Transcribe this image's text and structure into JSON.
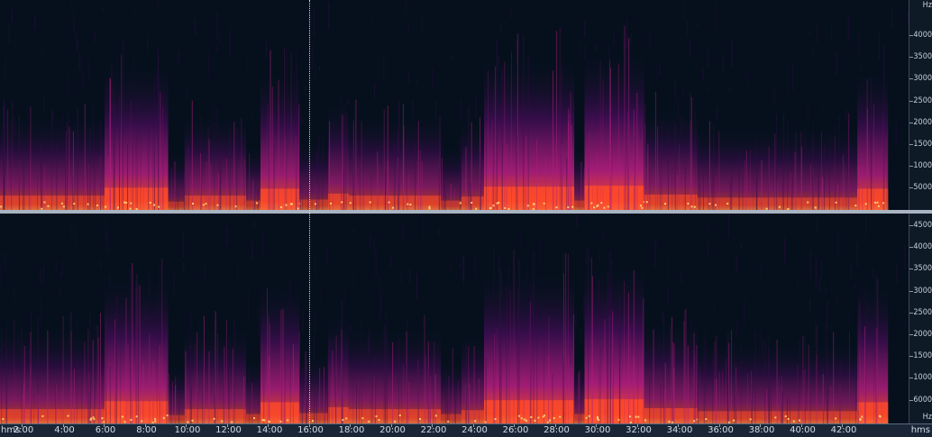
{
  "title": "",
  "time_axis": {
    "unit_left": "hms",
    "unit_right": "hms",
    "ticks": [
      {
        "label": "2:00",
        "minutes": 2
      },
      {
        "label": "4:00",
        "minutes": 4
      },
      {
        "label": "6:00",
        "minutes": 6
      },
      {
        "label": "8:00",
        "minutes": 8
      },
      {
        "label": "10:00",
        "minutes": 10
      },
      {
        "label": "12:00",
        "minutes": 12
      },
      {
        "label": "14:00",
        "minutes": 14
      },
      {
        "label": "16:00",
        "minutes": 16
      },
      {
        "label": "18:00",
        "minutes": 18
      },
      {
        "label": "20:00",
        "minutes": 20
      },
      {
        "label": "22:00",
        "minutes": 22
      },
      {
        "label": "24:00",
        "minutes": 24
      },
      {
        "label": "26:00",
        "minutes": 26
      },
      {
        "label": "28:00",
        "minutes": 28
      },
      {
        "label": "30:00",
        "minutes": 30
      },
      {
        "label": "32:00",
        "minutes": 32
      },
      {
        "label": "34:00",
        "minutes": 34
      },
      {
        "label": "36:00",
        "minutes": 36
      },
      {
        "label": "38:00",
        "minutes": 38
      },
      {
        "label": "40:00",
        "minutes": 40
      },
      {
        "label": "42:00",
        "minutes": 42
      }
    ],
    "cursor_minutes": 16
  },
  "freq_axis_top": {
    "unit": "Hz",
    "labels": [
      "4000",
      "3500",
      "3000",
      "2500",
      "2000",
      "1500",
      "1000",
      "5000"
    ]
  },
  "freq_axis_bottom": {
    "unit": "Hz",
    "labels": [
      "4500",
      "4000",
      "3500",
      "3000",
      "2500",
      "2000",
      "1500",
      "1000",
      "6000"
    ]
  },
  "colors": {
    "background": "#06101d",
    "low": "#3a0d4e",
    "mid": "#b01e7c",
    "high": "#ff4a2a",
    "peak": "#ffe27a",
    "cursor": "#e8e860"
  },
  "segments": [
    {
      "start": 0.0,
      "end": 5.1,
      "level": 0.45
    },
    {
      "start": 5.1,
      "end": 8.2,
      "level": 0.85
    },
    {
      "start": 8.2,
      "end": 9.0,
      "level": 0.15
    },
    {
      "start": 9.0,
      "end": 12.0,
      "level": 0.45
    },
    {
      "start": 12.0,
      "end": 12.7,
      "level": 0.2
    },
    {
      "start": 12.7,
      "end": 14.6,
      "level": 0.8
    },
    {
      "start": 14.6,
      "end": 16.0,
      "level": 0.25
    },
    {
      "start": 16.0,
      "end": 17.0,
      "level": 0.55
    },
    {
      "start": 17.0,
      "end": 21.5,
      "level": 0.45
    },
    {
      "start": 21.5,
      "end": 22.5,
      "level": 0.2
    },
    {
      "start": 22.5,
      "end": 23.6,
      "level": 0.4
    },
    {
      "start": 23.6,
      "end": 28.0,
      "level": 0.9
    },
    {
      "start": 28.0,
      "end": 28.5,
      "level": 0.2
    },
    {
      "start": 28.5,
      "end": 31.4,
      "level": 0.95
    },
    {
      "start": 31.4,
      "end": 34.0,
      "level": 0.5
    },
    {
      "start": 34.0,
      "end": 41.8,
      "level": 0.35
    },
    {
      "start": 41.8,
      "end": 43.3,
      "level": 0.8
    }
  ]
}
